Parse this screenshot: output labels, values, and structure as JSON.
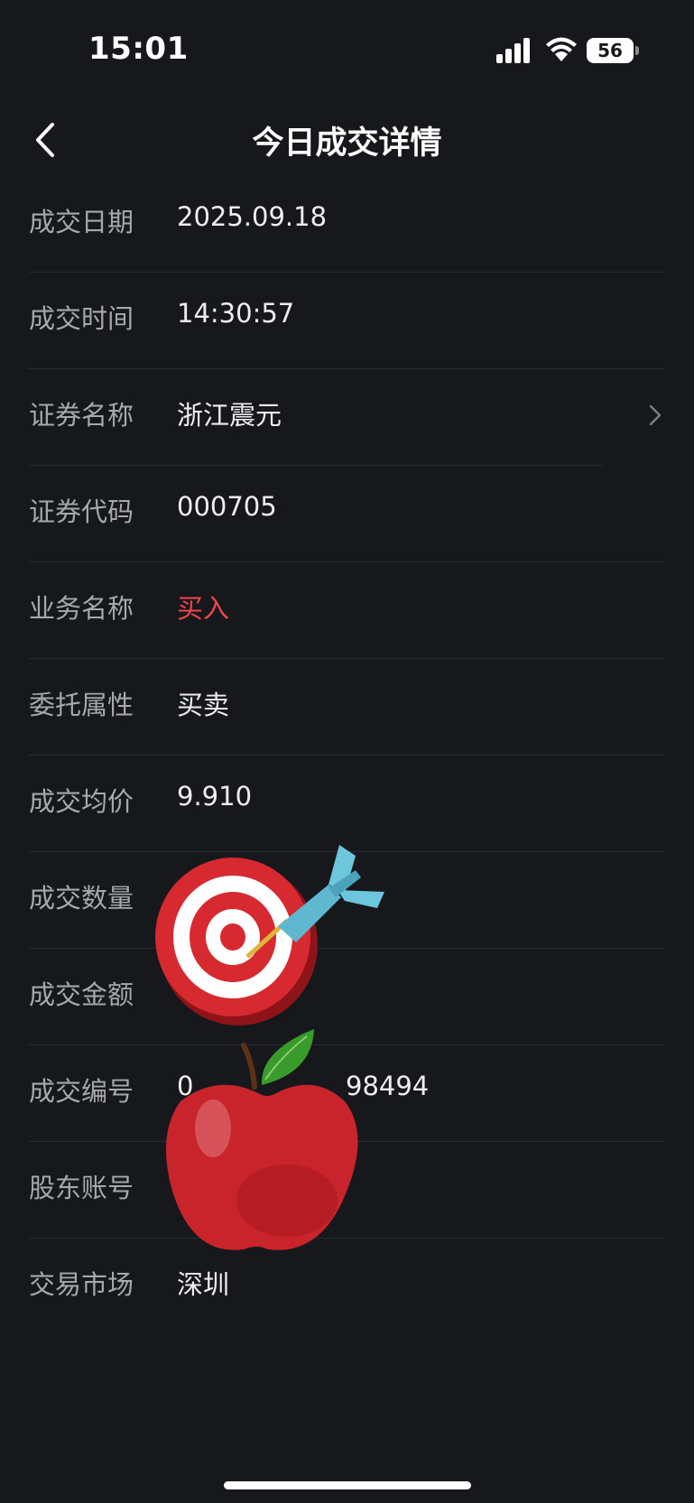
{
  "status_bar": {
    "time": "15:01",
    "battery": "56",
    "icons": [
      "signal-icon",
      "wifi-icon",
      "battery-icon"
    ]
  },
  "nav": {
    "title": "今日成交详情",
    "back_icon": "chevron-left-icon"
  },
  "rows": [
    {
      "label": "成交日期",
      "value": "2025.09.18"
    },
    {
      "label": "成交时间",
      "value": "14:30:57"
    },
    {
      "label": "证券名称",
      "value": "浙江震元",
      "has_chevron": true
    },
    {
      "label": "证券代码",
      "value": "000705"
    },
    {
      "label": "业务名称",
      "value": "买入",
      "color": "#f0464b"
    },
    {
      "label": "委托属性",
      "value": "买卖"
    },
    {
      "label": "成交均价",
      "value": "9.910"
    },
    {
      "label": "成交数量",
      "value": ""
    },
    {
      "label": "成交金额",
      "value": ""
    },
    {
      "label": "成交编号",
      "value": "0",
      "value_tail": "98494"
    },
    {
      "label": "股东账号",
      "value": ""
    },
    {
      "label": "交易市场",
      "value": "深圳"
    }
  ],
  "stickers": [
    "dart-target-icon",
    "red-apple-icon"
  ]
}
